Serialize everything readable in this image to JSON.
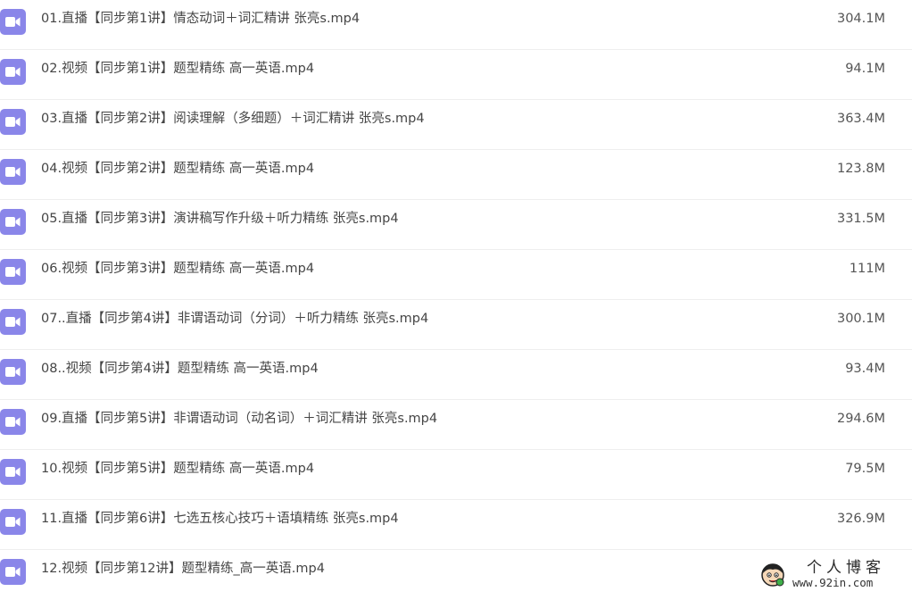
{
  "files": [
    {
      "name": "01.直播【同步第1讲】情态动词＋词汇精讲 张亮s.mp4",
      "size": "304.1M",
      "icon": "video-icon"
    },
    {
      "name": "02.视频【同步第1讲】题型精练 高一英语.mp4",
      "size": "94.1M",
      "icon": "video-icon"
    },
    {
      "name": "03.直播【同步第2讲】阅读理解（多细题）＋词汇精讲 张亮s.mp4",
      "size": "363.4M",
      "icon": "video-icon"
    },
    {
      "name": "04.视频【同步第2讲】题型精练 高一英语.mp4",
      "size": "123.8M",
      "icon": "video-icon"
    },
    {
      "name": "05.直播【同步第3讲】演讲稿写作升级＋听力精练 张亮s.mp4",
      "size": "331.5M",
      "icon": "video-icon"
    },
    {
      "name": "06.视频【同步第3讲】题型精练 高一英语.mp4",
      "size": "111M",
      "icon": "video-icon"
    },
    {
      "name": "07..直播【同步第4讲】非谓语动词（分词）＋听力精练 张亮s.mp4",
      "size": "300.1M",
      "icon": "video-icon"
    },
    {
      "name": "08..视频【同步第4讲】题型精练 高一英语.mp4",
      "size": "93.4M",
      "icon": "video-icon"
    },
    {
      "name": "09.直播【同步第5讲】非谓语动词（动名词）＋词汇精讲 张亮s.mp4",
      "size": "294.6M",
      "icon": "video-icon"
    },
    {
      "name": "10.视频【同步第5讲】题型精练 高一英语.mp4",
      "size": "79.5M",
      "icon": "video-icon"
    },
    {
      "name": "11.直播【同步第6讲】七选五核心技巧＋语填精练 张亮s.mp4",
      "size": "326.9M",
      "icon": "video-icon"
    },
    {
      "name": "12.视频【同步第12讲】题型精练_高一英语.mp4",
      "size": "",
      "icon": "video-icon"
    }
  ],
  "watermark": {
    "title": "个人博客",
    "url": "www.92in.com"
  },
  "colors": {
    "icon_bg": "#8a86e9",
    "icon_fg": "#ffffff",
    "text": "#454545",
    "divider": "#eeeeee"
  }
}
